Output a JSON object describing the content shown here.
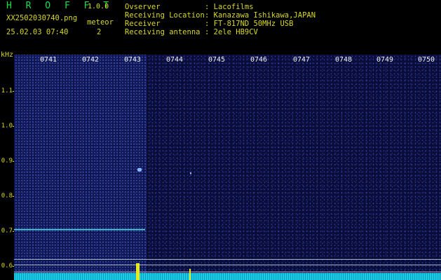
{
  "header": {
    "app_name": "H R O F F T",
    "app_version": "1.0.0",
    "filename": "XX2502030740.png",
    "meteor_label": "meteor",
    "meteor_count": "2",
    "datetime": "25.02.03 07:40",
    "info": [
      {
        "key": "Ovserver",
        "value": ": Lacofilms"
      },
      {
        "key": "Receiving Location",
        "value": ": Kanazawa Ishikawa,JAPAN"
      },
      {
        "key": "Receiver",
        "value": ": FT-817ND 50MHz USB"
      },
      {
        "key": "Receiving antenna",
        "value": ": 2ele HB9CV"
      }
    ]
  },
  "axis": {
    "y_unit": "kHz",
    "y_ticks": [
      "1.1",
      "1.0",
      "0.9",
      "0.8",
      "0.7",
      "0.6"
    ],
    "x_ticks": [
      "0741",
      "0742",
      "0743",
      "0744",
      "0745",
      "0746",
      "0747",
      "0748",
      "0749",
      "0750"
    ]
  },
  "colors": {
    "background": "#000000",
    "header_text": "#d8d820",
    "title_green": "#19e04a",
    "spectrum_bg": "#0a0d3a",
    "carrier": "#3bb6c8",
    "peak": "#e8e820"
  }
}
